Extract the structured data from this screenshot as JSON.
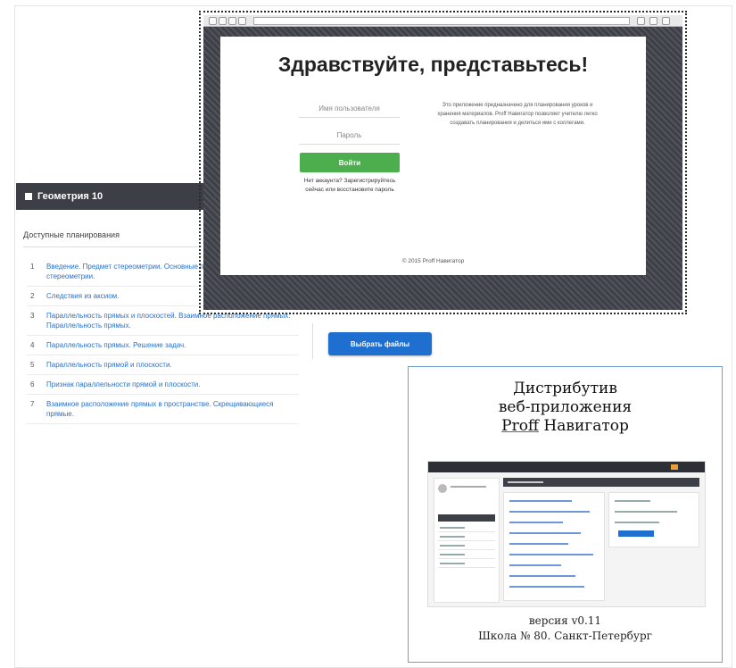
{
  "course": {
    "title": "Геометрия 10",
    "plans_title": "Доступные планирования",
    "topics": [
      {
        "num": "1",
        "text": "Введение. Предмет стереометрии. Основные понятия и аксиомы стереометрии."
      },
      {
        "num": "2",
        "text": "Следствия из аксиом."
      },
      {
        "num": "3",
        "text": "Параллельность прямых и плоскостей. Взаимное расположение прямых. Параллельность прямых."
      },
      {
        "num": "4",
        "text": "Параллельность прямых. Решение задач."
      },
      {
        "num": "5",
        "text": "Параллельность прямой и плоскости."
      },
      {
        "num": "6",
        "text": "Признак параллельности прямой и плоскости."
      },
      {
        "num": "7",
        "text": "Взаимное расположение прямых в пространстве. Скрещивающиеся прямые."
      }
    ]
  },
  "upload": {
    "choose_label": "Выбрать файлы"
  },
  "login": {
    "title": "Здравствуйте, представьтесь!",
    "username_placeholder": "Имя пользователя",
    "password_placeholder": "Пароль",
    "login_label": "Войти",
    "register_text": "Нет аккаунта? Зарегистрируйтесь сейчас или восстановите пароль",
    "description": "Это приложение предназначено для планирования уроков и хранения материалов. Proff Навигатор позволяет учителю легко создавать планирования и делиться ими с коллегами.",
    "footer": "© 2015 Proff Навигатор"
  },
  "distribution": {
    "title_line1": "Дистрибутив",
    "title_line2": "веб-приложения",
    "title_brand": "Proff",
    "title_rest": " Навигатор",
    "version": "версия v0.11",
    "school": "Школа № 80. Санкт-Петербург"
  }
}
